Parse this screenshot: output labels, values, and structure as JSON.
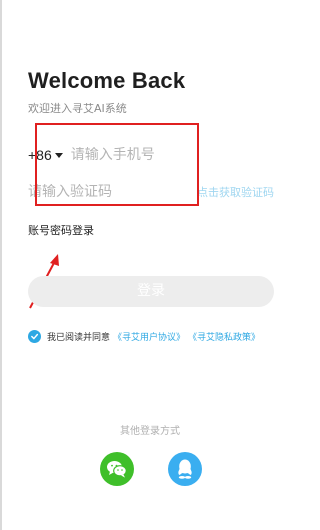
{
  "header": {
    "title": "Welcome Back",
    "subtitle": "欢迎进入寻艾AI系统"
  },
  "form": {
    "country_code": "+86",
    "phone_placeholder": "请输入手机号",
    "code_placeholder": "请输入验证码",
    "get_code_label": "点击获取验证码",
    "password_login_label": "账号密码登录",
    "login_button_label": "登录"
  },
  "agreement": {
    "checked": true,
    "text": "我已阅读并同意",
    "user_agreement": "《寻艾用户协议》",
    "privacy_policy": "《寻艾隐私政策》"
  },
  "other_login": {
    "title": "其他登录方式",
    "options": [
      {
        "icon": "wechat-icon",
        "color": "#3fbf2a"
      },
      {
        "icon": "qq-icon",
        "color": "#3aaef0"
      }
    ]
  },
  "colors": {
    "accent": "#2ea8e3",
    "annotation": "#e02020"
  }
}
